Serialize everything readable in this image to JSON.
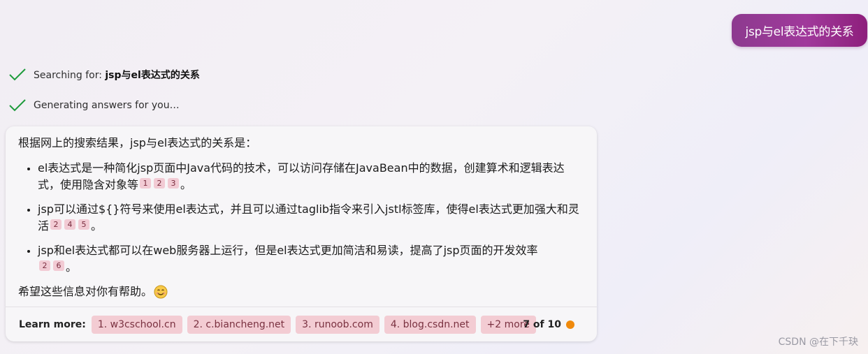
{
  "user_message": "jsp与el表达式的关系",
  "status": [
    {
      "prefix": "Searching for: ",
      "bold": "jsp与el表达式的关系"
    },
    {
      "prefix": "Generating answers for you…",
      "bold": ""
    }
  ],
  "answer": {
    "intro": "根据网上的搜索结果，jsp与el表达式的关系是：",
    "bullets": [
      {
        "text": "el表达式是一种简化jsp页面中Java代码的技术，可以访问存储在JavaBean中的数据，创建算术和逻辑表达式，使用隐含对象等",
        "cites": [
          "1",
          "2",
          "3"
        ],
        "end": "。"
      },
      {
        "text": "jsp可以通过${}符号来使用el表达式，并且可以通过taglib指令来引入jstl标签库，使得el表达式更加强大和灵活",
        "cites": [
          "2",
          "4",
          "5"
        ],
        "end": "。"
      },
      {
        "text": "jsp和el表达式都可以在web服务器上运行，但是el表达式更加简洁和易读，提高了jsp页面的开发效率",
        "cites": [
          "2",
          "6"
        ],
        "end": "。"
      }
    ],
    "closing": "希望这些信息对你有帮助。"
  },
  "learn_more": {
    "label": "Learn more:",
    "sources": [
      "1. w3cschool.cn",
      "2. c.biancheng.net",
      "3. runoob.com",
      "4. blog.csdn.net"
    ],
    "more": "+2 more"
  },
  "counter": "7 of 10",
  "colors": {
    "user_bubble": "#9b3a96",
    "status_dot": "#f08a0c",
    "check": "#1e9b3c",
    "cite_bg": "#f2cbd4"
  },
  "watermark": "CSDN @在下千玦"
}
